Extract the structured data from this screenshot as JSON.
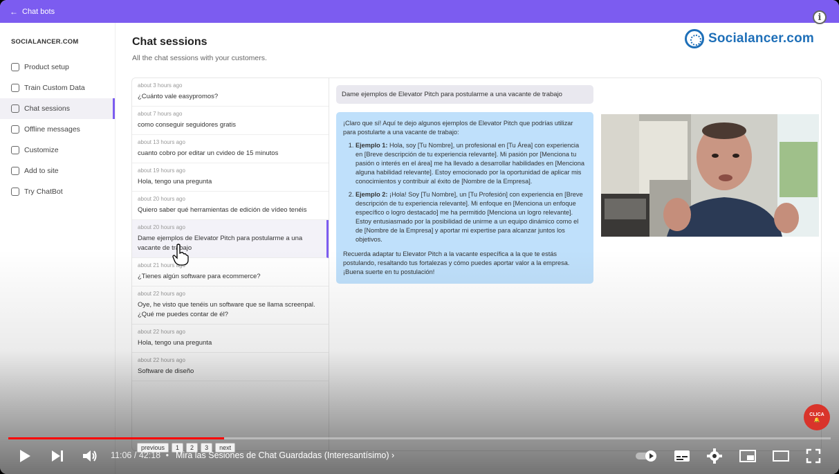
{
  "topbar": {
    "back_label": "Chat bots"
  },
  "sidebar": {
    "brand": "SOCIALANCER.COM",
    "items": [
      {
        "label": "Product setup",
        "icon": "home-icon"
      },
      {
        "label": "Train Custom Data",
        "icon": "database-icon"
      },
      {
        "label": "Chat sessions",
        "icon": "chat-icon",
        "active": true
      },
      {
        "label": "Offline messages",
        "icon": "mail-icon"
      },
      {
        "label": "Customize",
        "icon": "palette-icon"
      },
      {
        "label": "Add to site",
        "icon": "embed-icon"
      },
      {
        "label": "Try ChatBot",
        "icon": "chatbot-icon"
      }
    ]
  },
  "header": {
    "title": "Chat sessions",
    "subtitle": "All the chat sessions with your customers.",
    "logo_text": "Socialancer.com"
  },
  "sessions": [
    {
      "time": "about 3 hours ago",
      "message": "¿Cuánto vale easypromos?"
    },
    {
      "time": "about 7 hours ago",
      "message": "como conseguir seguidores gratis"
    },
    {
      "time": "about 13 hours ago",
      "message": "cuanto cobro por editar un cvideo de 15 minutos"
    },
    {
      "time": "about 19 hours ago",
      "message": "Hola, tengo una pregunta"
    },
    {
      "time": "about 20 hours ago",
      "message": "Quiero saber qué herramientas de edición de vídeo tenéis"
    },
    {
      "time": "about 20 hours ago",
      "message": "Dame ejemplos de Elevator Pitch para postularme a una vacante de trabajo",
      "selected": true
    },
    {
      "time": "about 21 hours ago",
      "message": "¿Tienes algún software para ecommerce?"
    },
    {
      "time": "about 22 hours ago",
      "message": "Oye, he visto que tenéis un software que se llama screenpal. ¿Qué me puedes contar de él?"
    },
    {
      "time": "about 22 hours ago",
      "message": "Hola, tengo una pregunta"
    },
    {
      "time": "about 22 hours ago",
      "message": "Software de diseño"
    }
  ],
  "chat": {
    "user_message": "Dame ejemplos de Elevator Pitch para postularme a una vacante de trabajo",
    "bot_intro": "¡Claro que sí! Aquí te dejo algunos ejemplos de Elevator Pitch que podrías utilizar para postularte a una vacante de trabajo:",
    "examples": [
      {
        "label": "Ejemplo 1:",
        "text": " Hola, soy [Tu Nombre], un profesional en [Tu Área] con experiencia en [Breve descripción de tu experiencia relevante]. Mi pasión por [Menciona tu pasión o interés en el área] me ha llevado a desarrollar habilidades en [Menciona alguna habilidad relevante]. Estoy emocionado por la oportunidad de aplicar mis conocimientos y contribuir al éxito de [Nombre de la Empresa]."
      },
      {
        "label": "Ejemplo 2:",
        "text": " ¡Hola! Soy [Tu Nombre], un [Tu Profesión] con experiencia en [Breve descripción de tu experiencia relevante]. Mi enfoque en [Menciona un enfoque específico o logro destacado] me ha permitido [Menciona un logro relevante]. Estoy entusiasmado por la posibilidad de unirme a un equipo dinámico como el de [Nombre de la Empresa] y aportar mi expertise para alcanzar juntos los objetivos."
      }
    ],
    "bot_outro": "Recuerda adaptar tu Elevator Pitch a la vacante específica a la que te estás postulando, resaltando tus fortalezas y cómo puedes aportar valor a la empresa. ¡Buena suerte en tu postulación!"
  },
  "pagination": {
    "previous": "previous",
    "pages": [
      "1",
      "2",
      "3"
    ],
    "next": "next"
  },
  "badge": {
    "line1": "CLICA"
  },
  "player": {
    "current_time": "11:06",
    "separator": "/",
    "duration": "42:18",
    "chapter": "Mira las Sesiones de Chat Guardadas (Interesantísimo)",
    "progress": 0.262,
    "colors": {
      "accent": "#7c5cf0",
      "played": "#ff0000",
      "link": "#1e6fb8"
    }
  }
}
